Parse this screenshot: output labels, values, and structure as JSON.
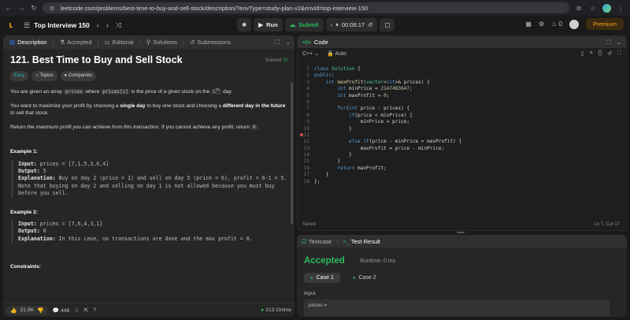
{
  "browser": {
    "url": "leetcode.com/problems/best-time-to-buy-and-sell-stock/description/?envType=study-plan-v2&envId=top-interview-150"
  },
  "topbar": {
    "list_title": "Top Interview 150",
    "run_label": "Run",
    "submit_label": "Submit",
    "timer": "00:08:17",
    "streak": "0",
    "premium_label": "Premium"
  },
  "left": {
    "tabs": [
      {
        "label": "Description"
      },
      {
        "label": "Accepted"
      },
      {
        "label": "Editorial"
      },
      {
        "label": "Solutions"
      },
      {
        "label": "Submissions"
      }
    ],
    "title": "121. Best Time to Buy and Sell Stock",
    "solved": "Solved",
    "chips": {
      "difficulty": "Easy",
      "topics": "Topics",
      "companies": "Companies"
    },
    "p1": {
      "a": "You are given an array ",
      "code1": "prices",
      "b": " where ",
      "code2": "prices[i]",
      "c": " is the price of a given stock on the ",
      "sup": "i",
      "d": "th",
      "e": " day."
    },
    "p2": {
      "a": "You want to maximize your profit by choosing a ",
      "b1": "single day",
      "c": " to buy one stock and choosing a ",
      "b2": "different day in the future",
      "d": " to sell that stock."
    },
    "p3": {
      "a": "Return ",
      "em": "the maximum profit you can achieve from this transaction",
      "b": ". If you cannot achieve any profit, return ",
      "code": "0",
      "c": "."
    },
    "example1": {
      "title": "Example 1:",
      "input_label": "Input:",
      "input": " prices = [7,1,5,3,6,4]",
      "output_label": "Output:",
      "output": " 5",
      "expl_label": "Explanation:",
      "expl": " Buy on day 2 (price = 1) and sell on day 5 (price = 6), profit = 6-1 = 5.",
      "note": "Note that buying on day 2 and selling on day 1 is not allowed because you must buy before you sell."
    },
    "example2": {
      "title": "Example 2:",
      "input_label": "Input:",
      "input": " prices = [7,6,4,3,1]",
      "output_label": "Output:",
      "output": " 0",
      "expl_label": "Explanation:",
      "expl": " In this case, no transactions are done and the max profit = 0."
    },
    "constraints_title": "Constraints:",
    "footer": {
      "likes": "31.9K",
      "comments": "446",
      "online": "213 Online"
    }
  },
  "code_panel": {
    "title": "Code",
    "language": "C++",
    "mode": "Auto",
    "status": "Saved",
    "cursor": "Ln 7, Col 17",
    "lines": [
      "class Solution {",
      "public:",
      "    int maxProfit(vector<int>& prices) {",
      "        int minPrice = 2147483647;",
      "        int maxProfit = 0;",
      "",
      "        for(int price : prices) {",
      "            if(price < minPrice) {",
      "                minPrice = price;",
      "            }",
      "",
      "            else if(price - minPrice > maxProfit) {",
      "                maxProfit = price - minPrice;",
      "            }",
      "        }",
      "        return maxProfit;",
      "    }",
      "};"
    ]
  },
  "test_panel": {
    "tab_testcase": "Testcase",
    "tab_result": "Test Result",
    "verdict": "Accepted",
    "runtime": "Runtime: 0 ms",
    "case1": "Case 1",
    "case2": "Case 2",
    "input_label": "Input",
    "input_value": "prices ="
  }
}
